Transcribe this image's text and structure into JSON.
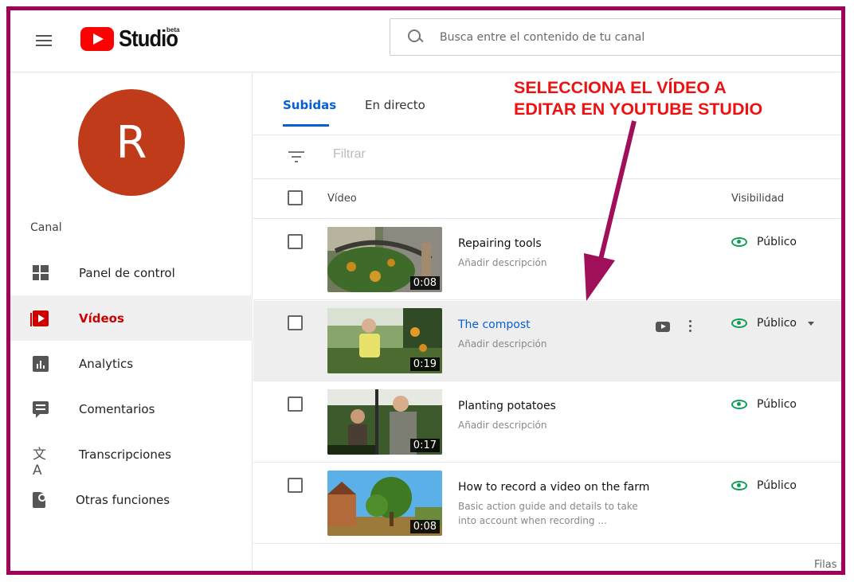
{
  "header": {
    "logo_text": "Studio",
    "logo_badge": "beta",
    "search_placeholder": "Busca entre el contenido de tu canal"
  },
  "sidebar": {
    "avatar_letter": "R",
    "section_label": "Canal",
    "items": [
      {
        "label": "Panel de control",
        "icon": "dashboard-icon",
        "active": false
      },
      {
        "label": "Vídeos",
        "icon": "videos-icon",
        "active": true
      },
      {
        "label": "Analytics",
        "icon": "analytics-icon",
        "active": false
      },
      {
        "label": "Comentarios",
        "icon": "comments-icon",
        "active": false
      },
      {
        "label": "Transcripciones",
        "icon": "translate-icon",
        "active": false
      },
      {
        "label": "Otras funciones",
        "icon": "other-features-icon",
        "active": false
      }
    ]
  },
  "main": {
    "tabs": [
      {
        "label": "Subidas",
        "active": true
      },
      {
        "label": "En directo",
        "active": false
      }
    ],
    "filter_placeholder": "Filtrar",
    "columns": {
      "video": "Vídeo",
      "visibility": "Visibilidad"
    },
    "videos": [
      {
        "title": "Repairing tools",
        "description": "Añadir descripción",
        "duration": "0:08",
        "visibility": "Público"
      },
      {
        "title": "The compost",
        "description": "Añadir descripción",
        "duration": "0:19",
        "visibility": "Público"
      },
      {
        "title": "Planting potatoes",
        "description": "Añadir descripción",
        "duration": "0:17",
        "visibility": "Público"
      },
      {
        "title": "How to record a video on the farm",
        "description": "Basic action guide and details to take into account when recording ...",
        "duration": "0:08",
        "visibility": "Público"
      }
    ],
    "footer_partial": "Filas p"
  },
  "annotation": {
    "line1": "SELECCIONA EL VÍDEO A",
    "line2": "EDITAR EN YOUTUBE STUDIO",
    "color": "#ee1111",
    "arrow_color": "#a0105a"
  },
  "colors": {
    "brand_red": "#ff0000",
    "active_red": "#cc0000",
    "link_blue": "#065fd4",
    "public_green": "#0f9d58",
    "frame_border": "#a00055",
    "avatar_bg": "#bf3b1a"
  }
}
